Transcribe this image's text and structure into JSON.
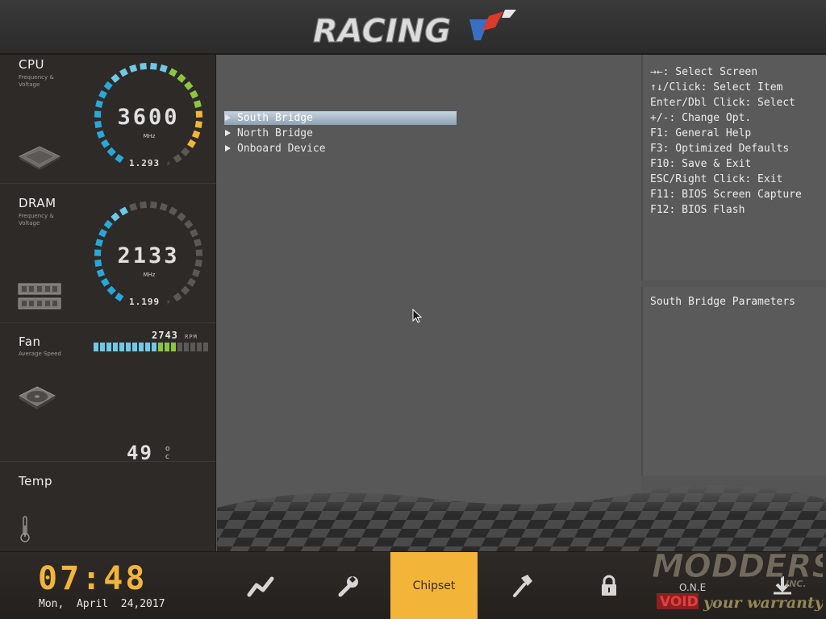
{
  "header": {
    "logo": "RACING"
  },
  "sidebar": {
    "cpu": {
      "title": "CPU",
      "subtitle": "Frequency & Voltage",
      "value": "3600",
      "unit": "MHz",
      "voltage": "1.293",
      "gauge_active_segments": 24,
      "gauge_total_segments": 26
    },
    "dram": {
      "title": "DRAM",
      "subtitle": "Frequency & Voltage",
      "value": "2133",
      "unit": "MHz",
      "voltage": "1.199",
      "gauge_active_segments": 11,
      "gauge_total_segments": 26
    },
    "fan": {
      "title": "Fan",
      "subtitle": "Average Speed",
      "value": "2743",
      "unit": "RPM",
      "bar_active_segments": 13,
      "bar_total_segments": 18
    },
    "temp": {
      "title": "Temp",
      "value": "49",
      "unit_degree": "o",
      "unit_letter": "c"
    }
  },
  "menu": {
    "items": [
      {
        "label": "South Bridge",
        "selected": true
      },
      {
        "label": "North Bridge",
        "selected": false
      },
      {
        "label": "Onboard Device",
        "selected": false
      }
    ]
  },
  "help": {
    "lines": [
      "→←: Select Screen",
      "↑↓/Click: Select Item",
      "Enter/Dbl Click: Select",
      "+/-: Change Opt.",
      "F1: General Help",
      "F3: Optimized Defaults",
      "F10: Save & Exit",
      "ESC/Right Click: Exit",
      "F11: BIOS Screen Capture",
      "F12: BIOS Flash"
    ],
    "description": "South Bridge Parameters"
  },
  "footer": {
    "time": "07:48",
    "date": "Mon,  April  24,2017",
    "tabs": [
      {
        "icon": "performance-icon",
        "label": ""
      },
      {
        "icon": "wrench-icon",
        "label": ""
      },
      {
        "icon": "chipset-icon",
        "label": "Chipset",
        "active": true
      },
      {
        "icon": "hammer-icon",
        "label": ""
      },
      {
        "icon": "lock-icon",
        "label": ""
      },
      {
        "icon": "exit-icon",
        "label": ""
      }
    ]
  },
  "watermark": {
    "brand": "MODDERS",
    "suffix": "INC.",
    "line2": "O.N.E",
    "tag_void": "VOID",
    "tag_rest": "your warranty"
  },
  "colors": {
    "accent": "#f2b53a",
    "gauge_blue": "#29a8d8",
    "gauge_light_blue": "#6ec8e8",
    "gauge_green": "#8cc63f",
    "gauge_orange": "#f2b53a",
    "gauge_off": "#5c5855"
  }
}
